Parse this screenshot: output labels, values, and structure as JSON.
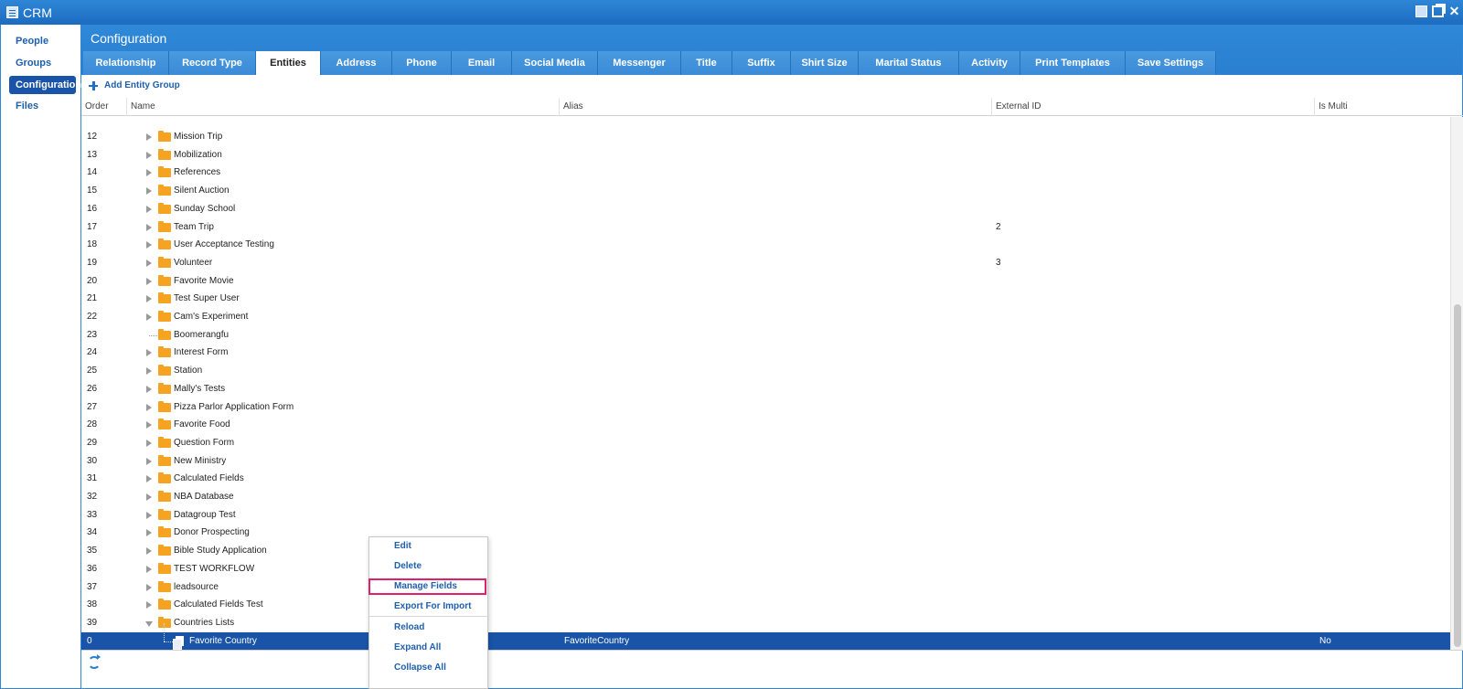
{
  "window": {
    "title": "CRM"
  },
  "sidebar": {
    "items": [
      {
        "label": "People",
        "active": false
      },
      {
        "label": "Groups",
        "active": false
      },
      {
        "label": "Configuration",
        "active": true
      },
      {
        "label": "Files",
        "active": false
      }
    ]
  },
  "main": {
    "title": "Configuration",
    "tabs": [
      {
        "label": "Relationship"
      },
      {
        "label": "Record Type"
      },
      {
        "label": "Entities",
        "active": true
      },
      {
        "label": "Address"
      },
      {
        "label": "Phone"
      },
      {
        "label": "Email"
      },
      {
        "label": "Social Media"
      },
      {
        "label": "Messenger"
      },
      {
        "label": "Title"
      },
      {
        "label": "Suffix"
      },
      {
        "label": "Shirt Size"
      },
      {
        "label": "Marital Status"
      },
      {
        "label": "Activity"
      },
      {
        "label": "Print Templates"
      },
      {
        "label": "Save Settings"
      }
    ],
    "add_entity_group_label": "Add Entity Group"
  },
  "grid": {
    "columns": [
      "Order",
      "Name",
      "Alias",
      "External ID",
      "Is Multi"
    ],
    "rows": [
      {
        "order": "12",
        "name": "Mission Trip",
        "external_id": ""
      },
      {
        "order": "13",
        "name": "Mobilization",
        "external_id": ""
      },
      {
        "order": "14",
        "name": "References",
        "external_id": ""
      },
      {
        "order": "15",
        "name": "Silent Auction",
        "external_id": ""
      },
      {
        "order": "16",
        "name": "Sunday School",
        "external_id": ""
      },
      {
        "order": "17",
        "name": "Team Trip",
        "external_id": "2"
      },
      {
        "order": "18",
        "name": "User Acceptance Testing",
        "external_id": ""
      },
      {
        "order": "19",
        "name": "Volunteer",
        "external_id": "3"
      },
      {
        "order": "20",
        "name": "Favorite Movie",
        "external_id": ""
      },
      {
        "order": "21",
        "name": "Test Super User",
        "external_id": ""
      },
      {
        "order": "22",
        "name": "Cam's Experiment",
        "external_id": ""
      },
      {
        "order": "23",
        "name": "Boomerangfu",
        "external_id": "",
        "leaf": true
      },
      {
        "order": "24",
        "name": "Interest Form",
        "external_id": ""
      },
      {
        "order": "25",
        "name": "Station",
        "external_id": ""
      },
      {
        "order": "26",
        "name": "Mally's Tests",
        "external_id": ""
      },
      {
        "order": "27",
        "name": "Pizza Parlor Application Form",
        "external_id": ""
      },
      {
        "order": "28",
        "name": "Favorite Food",
        "external_id": ""
      },
      {
        "order": "29",
        "name": "Question Form",
        "external_id": ""
      },
      {
        "order": "30",
        "name": "New Ministry",
        "external_id": ""
      },
      {
        "order": "31",
        "name": "Calculated Fields",
        "external_id": ""
      },
      {
        "order": "32",
        "name": "NBA Database",
        "external_id": ""
      },
      {
        "order": "33",
        "name": "Datagroup Test",
        "external_id": ""
      },
      {
        "order": "34",
        "name": "Donor Prospecting",
        "external_id": ""
      },
      {
        "order": "35",
        "name": "Bible Study Application",
        "external_id": ""
      },
      {
        "order": "36",
        "name": "TEST WORKFLOW",
        "external_id": ""
      },
      {
        "order": "37",
        "name": "leadsource",
        "external_id": ""
      },
      {
        "order": "38",
        "name": "Calculated Fields Test",
        "external_id": ""
      },
      {
        "order": "39",
        "name": "Countries Lists",
        "external_id": "",
        "expanded": true
      }
    ],
    "selected_row": {
      "order": "0",
      "name": "Favorite Country",
      "alias": "FavoriteCountry",
      "is_multi": "No"
    }
  },
  "context_menu": {
    "items": [
      "Edit",
      "Delete",
      "Manage Fields",
      "Export For Import",
      "Reload",
      "Expand All",
      "Collapse All"
    ],
    "highlighted": "Manage Fields"
  },
  "icons": {
    "folder_color": "#f6a321",
    "selection_color": "#1a54a8",
    "highlight_border_color": "#e0206a"
  }
}
